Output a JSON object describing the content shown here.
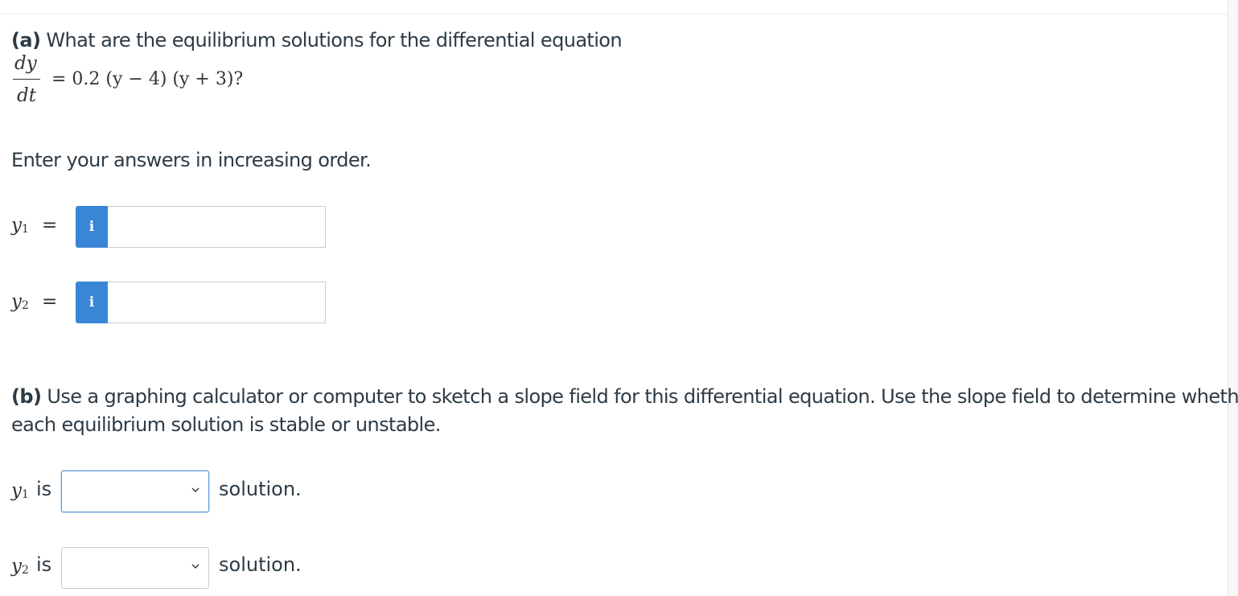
{
  "part_a": {
    "label": "(a)",
    "question": "What are the equilibrium solutions for the differential equation",
    "eq_numerator": "dy",
    "eq_denominator": "dt",
    "eq_rhs": "= 0.2 (y − 4) (y + 3)?",
    "instruction": "Enter your answers in increasing order.",
    "inputs": [
      {
        "var": "y",
        "sub": "1",
        "equals": "=",
        "info_symbol": "i",
        "value": ""
      },
      {
        "var": "y",
        "sub": "2",
        "equals": "=",
        "info_symbol": "i",
        "value": ""
      }
    ]
  },
  "part_b": {
    "label": "(b)",
    "question_line1": "Use a graphing calculator or computer to sketch a slope field for this differential equation. Use the slope field to determine whether",
    "question_line2": "each equilibrium solution is stable or unstable.",
    "rows": [
      {
        "var": "y",
        "sub": "1",
        "is": "is",
        "selected": "",
        "suffix": "solution."
      },
      {
        "var": "y",
        "sub": "2",
        "is": "is",
        "selected": "",
        "suffix": "solution."
      }
    ]
  },
  "colors": {
    "info_button": "#3a86d6",
    "focus_border": "#5b9bd5",
    "text": "#2d3b45"
  }
}
